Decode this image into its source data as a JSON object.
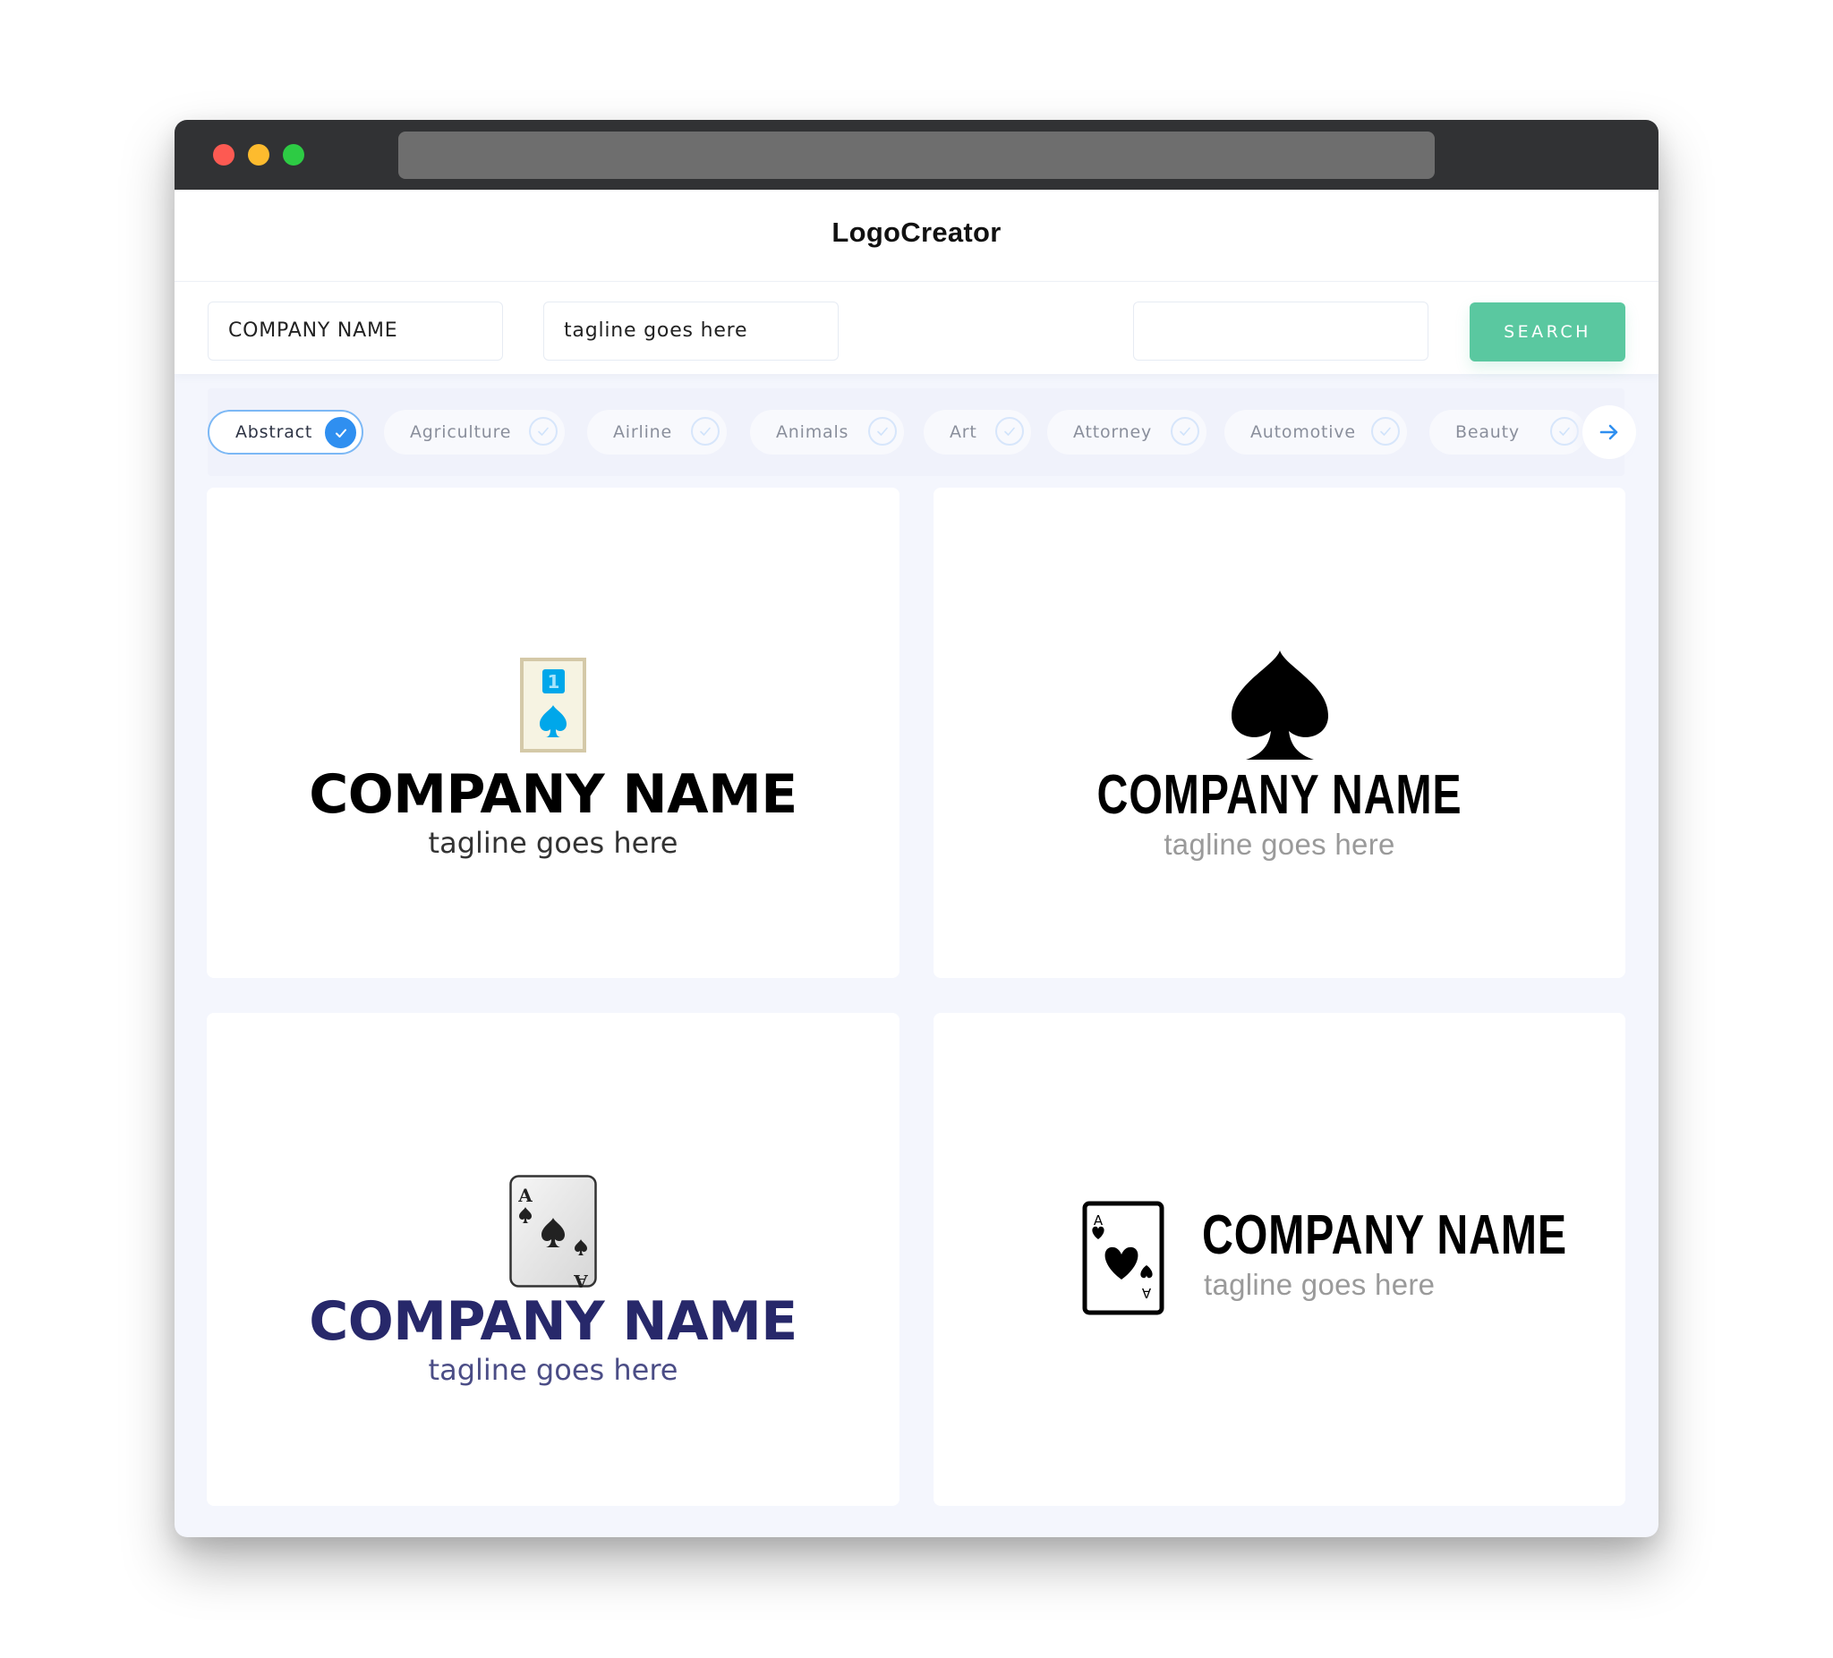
{
  "browser": {
    "controls": [
      "close",
      "minimize",
      "maximize"
    ],
    "colors": {
      "close": "#fd5a52",
      "minimize": "#fdbb2e",
      "maximize": "#2dcb44",
      "titlebar": "#313234",
      "urlbar": "#6e6e6e"
    }
  },
  "header": {
    "title": "LogoCreator"
  },
  "search": {
    "company_name_value": "COMPANY NAME",
    "tagline_value": "tagline goes here",
    "keyword_value": "",
    "button_label": "SEARCH",
    "button_color": "#5ac8a0"
  },
  "categories": {
    "items": [
      {
        "label": "Abstract",
        "selected": true
      },
      {
        "label": "Agriculture",
        "selected": false
      },
      {
        "label": "Airline",
        "selected": false
      },
      {
        "label": "Animals",
        "selected": false
      },
      {
        "label": "Art",
        "selected": false
      },
      {
        "label": "Attorney",
        "selected": false
      },
      {
        "label": "Automotive",
        "selected": false
      },
      {
        "label": "Beauty",
        "selected": false
      }
    ],
    "next_icon": "arrow-right-icon",
    "accent_color": "#2f8ff0"
  },
  "logos": [
    {
      "icon": "playing-card-one-spade-icon",
      "company_name": "COMPANY NAME",
      "tagline": "tagline goes here",
      "name_color": "#000000",
      "tagline_color": "#333333",
      "icon_color": "#00a7ea"
    },
    {
      "icon": "spade-icon",
      "company_name": "COMPANY NAME",
      "tagline": "tagline goes here",
      "name_color": "#000000",
      "tagline_color": "#9a9a9a"
    },
    {
      "icon": "ace-of-spades-card-icon",
      "company_name": "COMPANY NAME",
      "tagline": "tagline goes here",
      "name_color": "#27286a",
      "tagline_color": "#4b4d86"
    },
    {
      "icon": "ace-of-hearts-card-icon",
      "company_name": "COMPANY NAME",
      "tagline": "tagline goes here",
      "name_color": "#000000",
      "tagline_color": "#9a9a9a"
    }
  ]
}
